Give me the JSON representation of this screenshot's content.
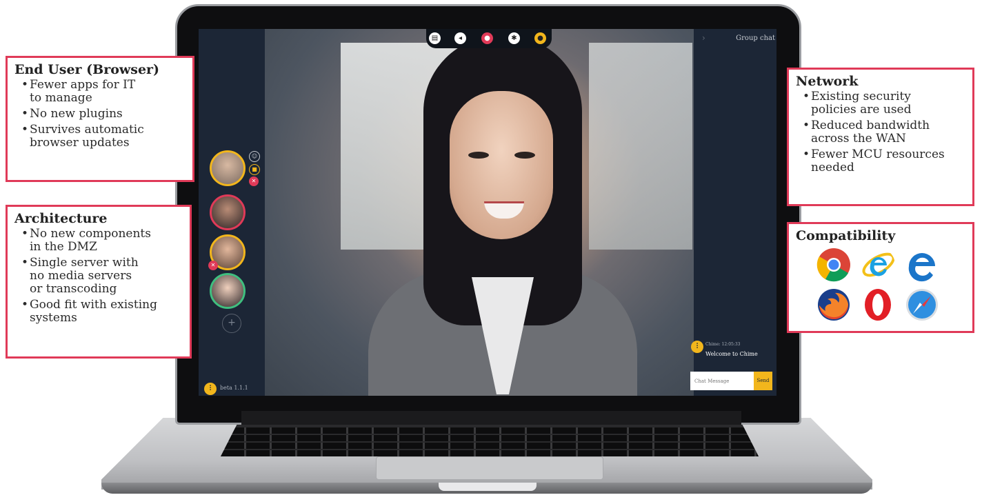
{
  "callouts": {
    "end_user": {
      "title": "End User (Browser)",
      "items": [
        "Fewer apps for IT\nto manage",
        "No new plugins",
        "Survives automatic\nbrowser updates"
      ]
    },
    "architecture": {
      "title": "Architecture",
      "items": [
        "No new components\nin the DMZ",
        "Single server with\nno media servers\nor transcoding",
        "Good fit with existing\nsystems"
      ]
    },
    "network": {
      "title": "Network",
      "items": [
        "Existing security\npolicies are used",
        "Reduced bandwidth\nacross the WAN",
        "Fewer MCU resources\nneeded"
      ]
    },
    "compatibility": {
      "title": "Compatibility",
      "browsers": [
        "chrome-icon",
        "internet-explorer-icon",
        "edge-icon",
        "firefox-icon",
        "opera-icon",
        "safari-icon"
      ]
    }
  },
  "app": {
    "panel_title": "Group chat",
    "version": "beta 1.1.1",
    "toolbar_icons": [
      "document-icon",
      "speaker-icon",
      "camera-icon",
      "settings-icon",
      "chat-icon"
    ],
    "chat": {
      "meta": "Chime: 12:05:33",
      "message": "Welcome to Chime",
      "input_placeholder": "Chat Message",
      "send_label": "Send"
    }
  },
  "colors": {
    "callout_border": "#e03a58",
    "accent": "#f2b61c",
    "panel": "#1c2636"
  }
}
